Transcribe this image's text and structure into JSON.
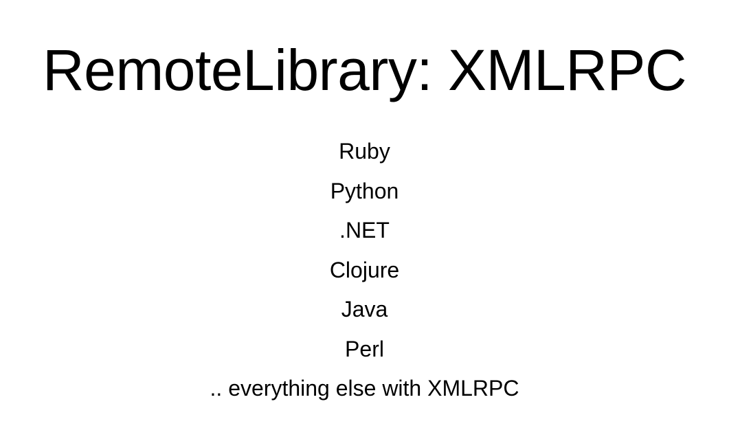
{
  "slide": {
    "title": "RemoteLibrary: XMLRPC",
    "items": [
      "Ruby",
      "Python",
      ".NET",
      "Clojure",
      "Java",
      "Perl",
      ".. everything else with XMLRPC"
    ]
  }
}
